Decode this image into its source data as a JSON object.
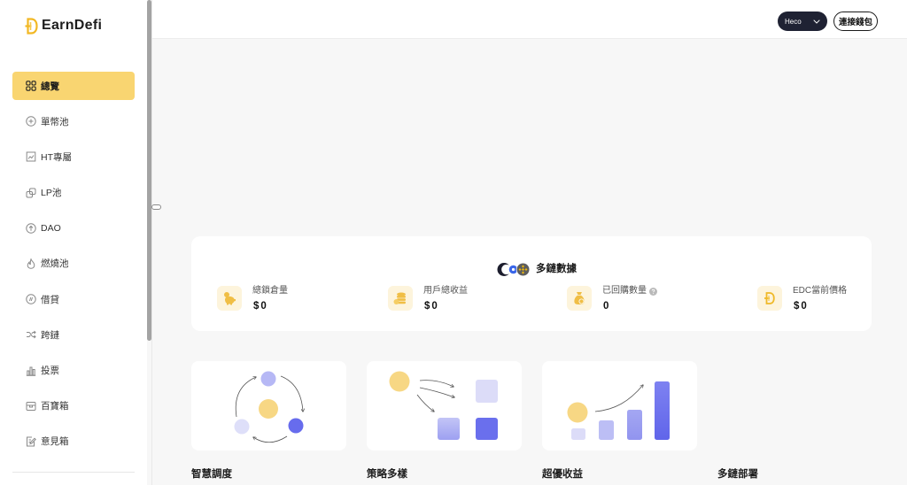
{
  "app": {
    "name": "EarnDefi"
  },
  "sidebar": {
    "items": [
      {
        "label": "總覽",
        "icon": "dashboard-grid-icon",
        "active": true
      },
      {
        "label": "單幣池",
        "icon": "single-coin-pool-icon"
      },
      {
        "label": "HT專屬",
        "icon": "ht-exclusive-icon"
      },
      {
        "label": "LP池",
        "icon": "lp-pool-icon"
      },
      {
        "label": "DAO",
        "icon": "dao-icon"
      },
      {
        "label": "燃燒池",
        "icon": "flame-icon"
      },
      {
        "label": "借貸",
        "icon": "lending-icon"
      },
      {
        "label": "跨鏈",
        "icon": "shuffle-icon"
      },
      {
        "label": "投票",
        "icon": "vote-chart-icon"
      },
      {
        "label": "百寶箱",
        "icon": "treasure-box-icon"
      },
      {
        "label": "意見箱",
        "icon": "feedback-icon"
      }
    ]
  },
  "header": {
    "network_select": {
      "value": "Heco",
      "icon": "chevron-down-icon"
    },
    "connect_wallet_label": "連接錢包"
  },
  "stats": {
    "title": "多鏈數據",
    "items": [
      {
        "label": "總鎖倉量",
        "value": "$0",
        "icon": "piggy-bank-icon"
      },
      {
        "label": "用戶總收益",
        "value": "$0",
        "icon": "coin-stack-icon"
      },
      {
        "label": "已回購數量",
        "value": "0",
        "icon": "money-bag-icon",
        "help": true
      },
      {
        "label": "EDC當前價格",
        "value": "$0",
        "icon": "edc-token-icon"
      }
    ]
  },
  "features": [
    {
      "label": "智慧調度"
    },
    {
      "label": "策略多樣"
    },
    {
      "label": "超優收益"
    },
    {
      "label": "多鏈部署"
    }
  ],
  "colors": {
    "accent": "#f9d571",
    "dark_button": "#1f2233",
    "gold": "#f7d784",
    "purple": "#6a6fed",
    "light_purple": "#dcdcf8",
    "background": "#f7f7f7"
  }
}
